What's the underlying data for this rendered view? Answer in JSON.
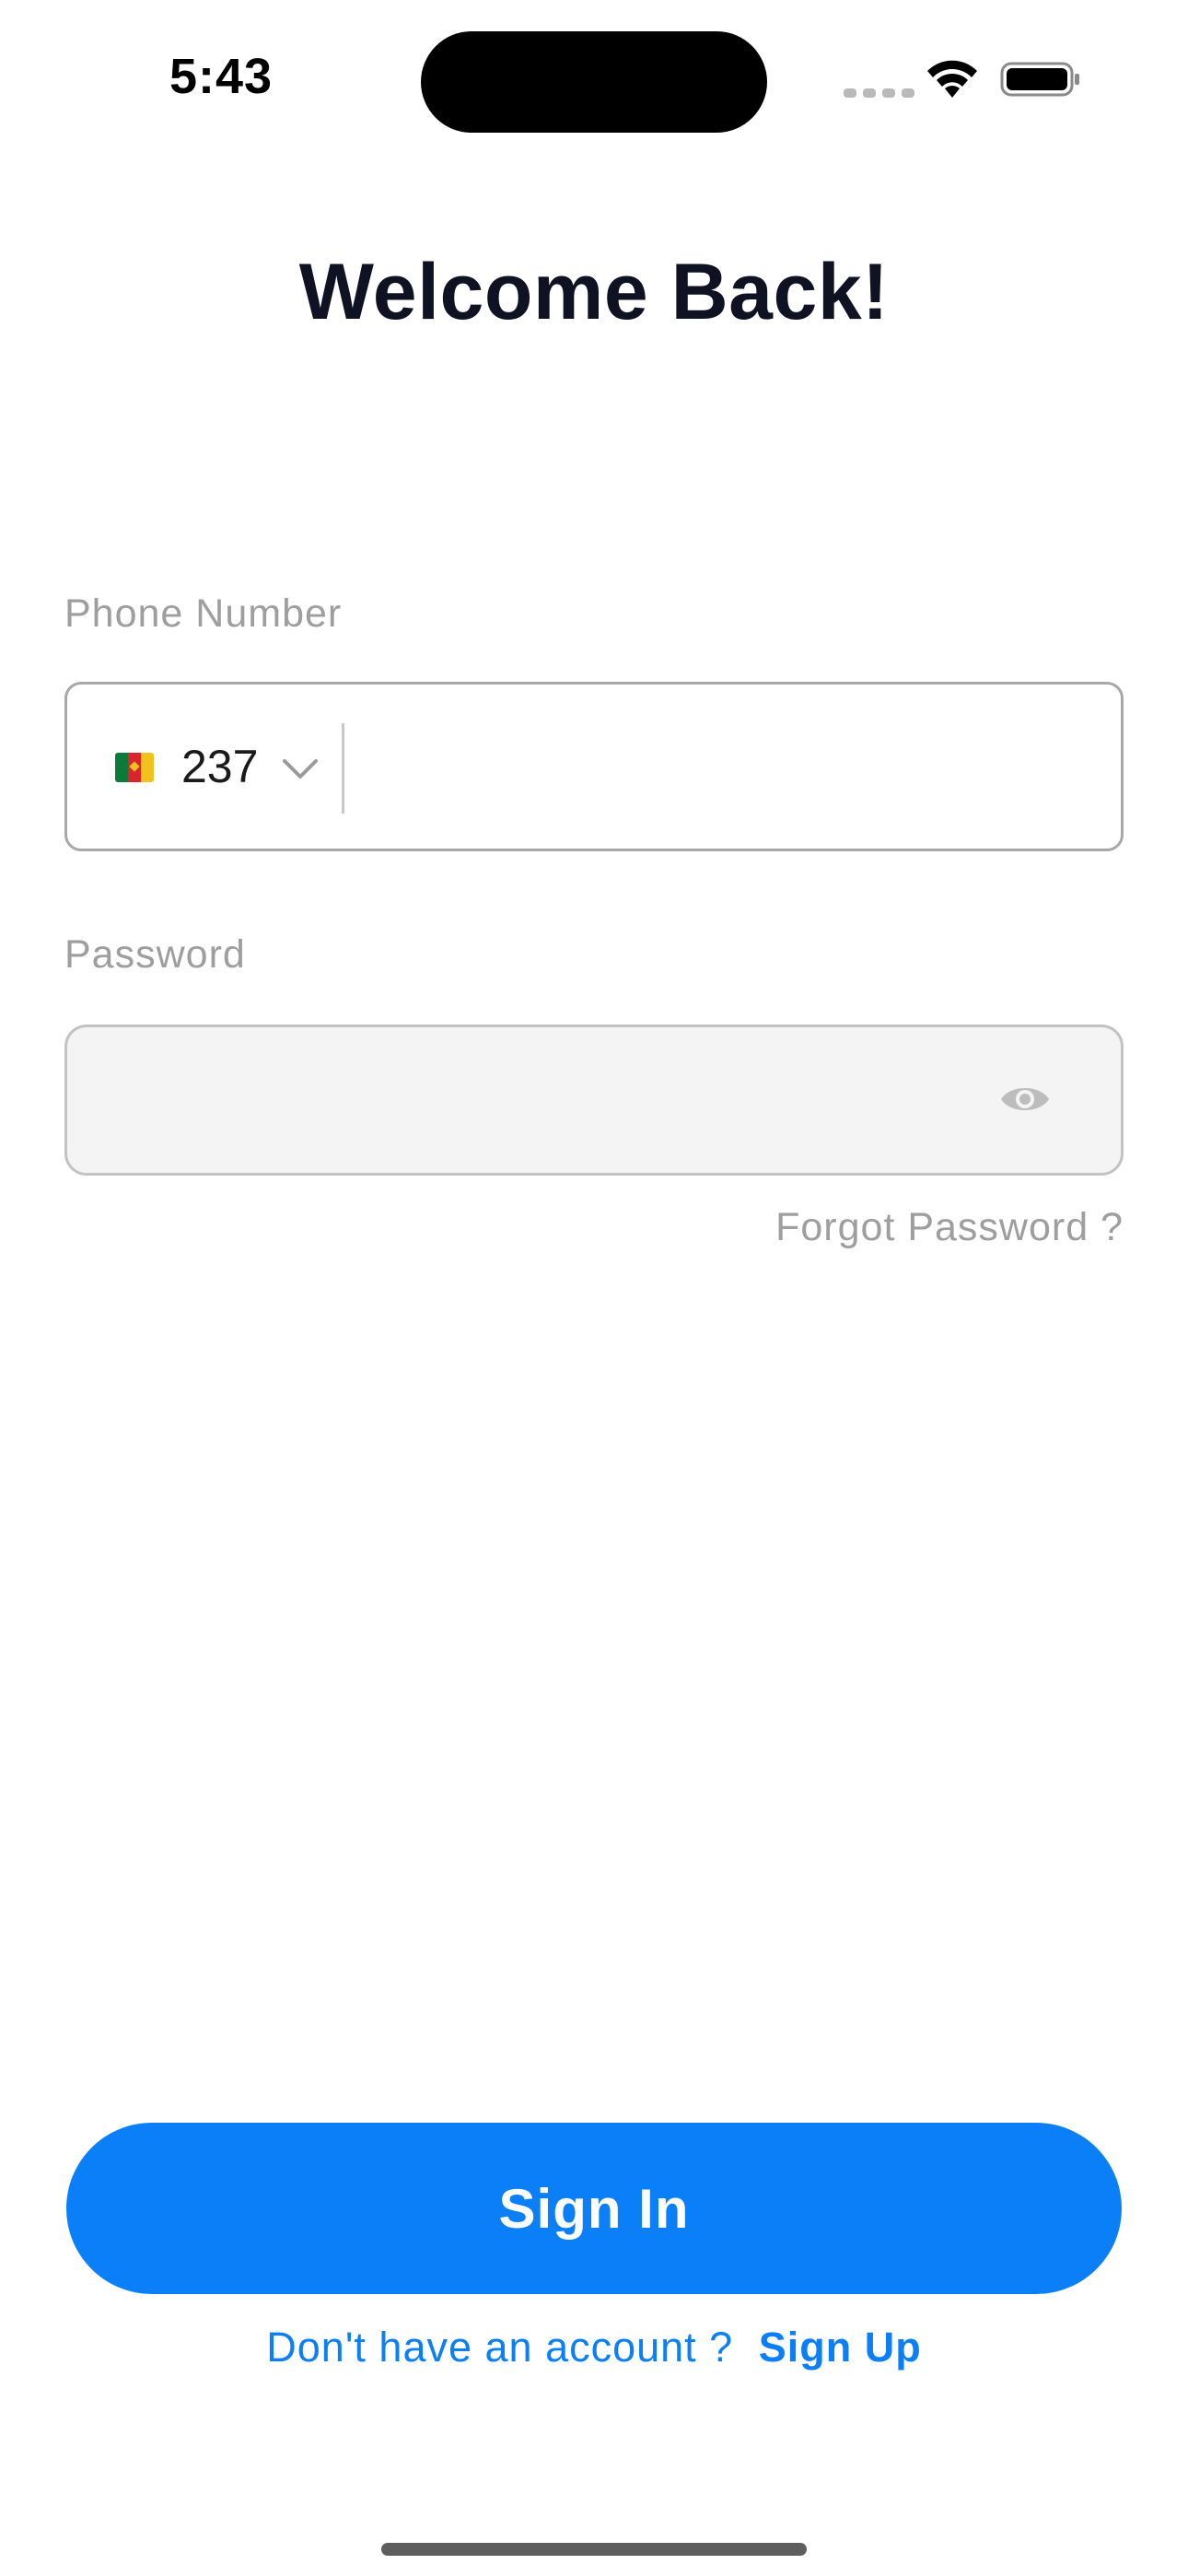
{
  "status_bar": {
    "time": "5:43",
    "icons": [
      "signal-icon",
      "wifi-icon",
      "battery-icon"
    ]
  },
  "page": {
    "title": "Welcome Back!"
  },
  "phone": {
    "label": "Phone Number",
    "country_flag": "cameroon-flag-icon",
    "country_code": "237",
    "value": "",
    "placeholder": ""
  },
  "password": {
    "label": "Password",
    "value": "",
    "placeholder": "",
    "toggle_icon": "eye-icon"
  },
  "forgot_password": {
    "label": "Forgot Password ?"
  },
  "actions": {
    "sign_in": "Sign In",
    "signup_prompt": "Don't have an account ?",
    "signup_link": "Sign Up"
  },
  "colors": {
    "primary": "#0a7ff8",
    "title": "#0f1222",
    "muted": "#9e9e9e",
    "field_bg": "#f4f4f4"
  }
}
